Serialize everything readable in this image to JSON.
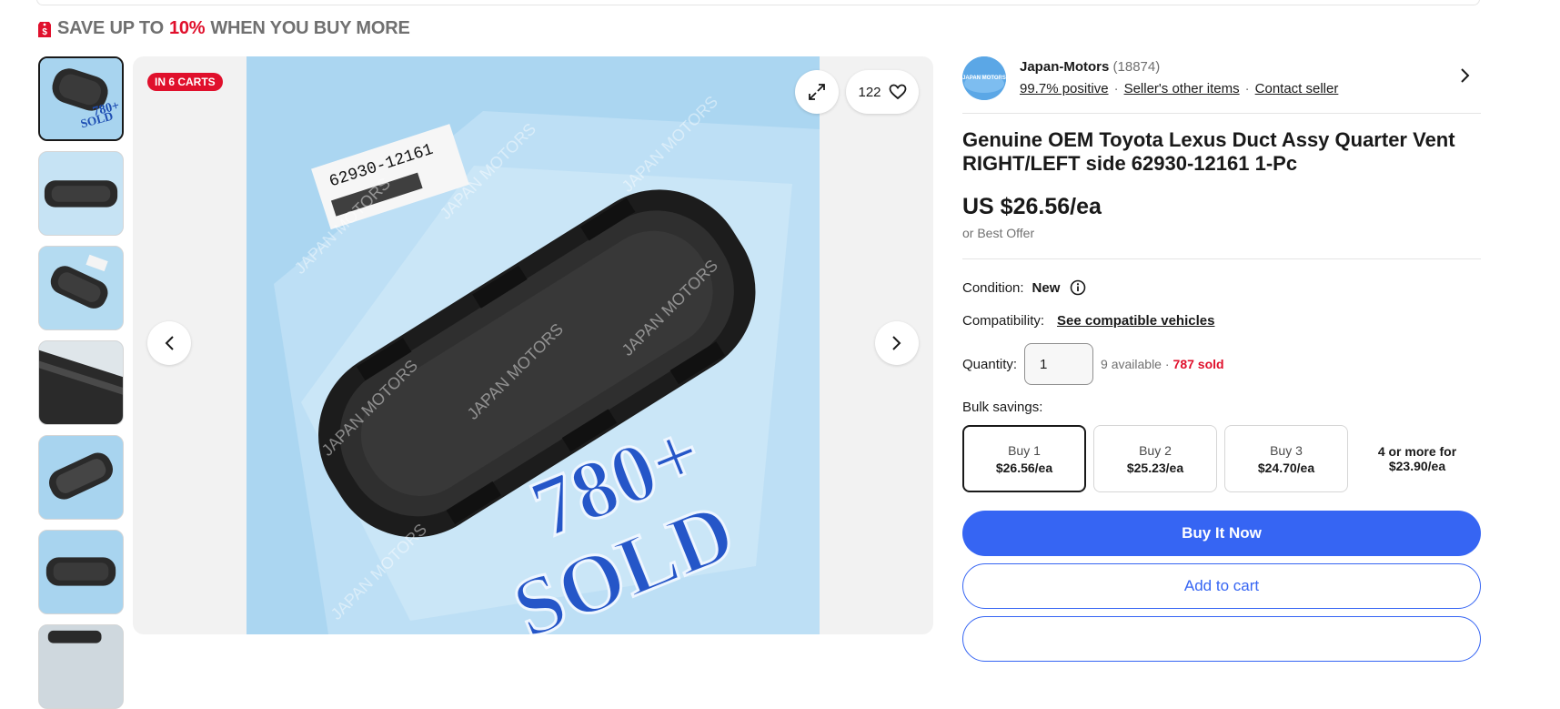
{
  "promo": {
    "prefix": "SAVE UP TO ",
    "percent": "10%",
    "suffix": " WHEN YOU BUY MORE",
    "icon": "price-tag-icon",
    "accent": "#e0102c"
  },
  "gallery": {
    "thumbnails_count": 7,
    "badge": "IN 6 CARTS",
    "watch_count": "122",
    "photo_text": {
      "line1": "780+",
      "line2": "SOLD",
      "watermark": "JAPAN MOTORS",
      "label_code": "62930-12161"
    }
  },
  "seller": {
    "name": "Japan-Motors",
    "count": "(18874)",
    "positive": "99.7% positive",
    "other_items": "Seller's other items",
    "contact": "Contact seller",
    "logo_text": "JAPAN MOTORS"
  },
  "item": {
    "title": "Genuine OEM Toyota Lexus Duct Assy Quarter Vent RIGHT/LEFT side 62930-12161 1-Pc",
    "price": "US $26.56/ea",
    "best_offer": "or Best Offer"
  },
  "condition": {
    "label": "Condition:",
    "value": "New"
  },
  "compatibility": {
    "label": "Compatibility:",
    "link": "See compatible vehicles"
  },
  "quantity": {
    "label": "Quantity:",
    "value": "1",
    "available": "9 available · ",
    "sold": "787 sold"
  },
  "bulk": {
    "label": "Bulk savings:",
    "options": [
      {
        "label": "Buy 1",
        "price": "$26.56/ea"
      },
      {
        "label": "Buy 2",
        "price": "$25.23/ea"
      },
      {
        "label": "Buy 3",
        "price": "$24.70/ea"
      }
    ],
    "more_line1": "4 or more for",
    "more_line2": "$23.90/ea"
  },
  "actions": {
    "buy_now": "Buy It Now",
    "add_to_cart": "Add to cart"
  },
  "colors": {
    "primary": "#3665f3",
    "alert": "#e0102c"
  }
}
